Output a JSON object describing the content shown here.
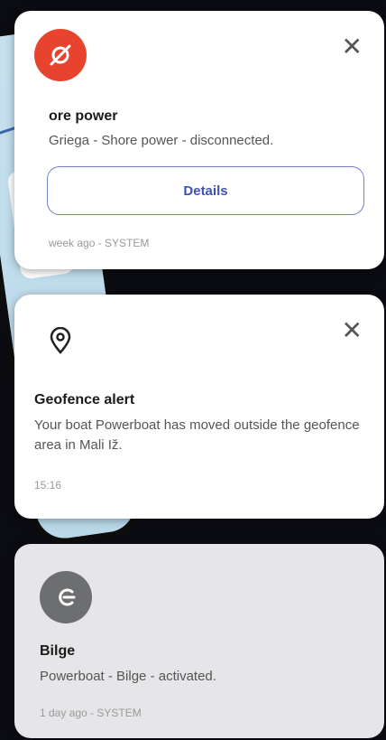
{
  "notifications": [
    {
      "icon": "plug-icon",
      "accent": "#e8432f",
      "title": "ore power",
      "body": "Griega - Shore power - disconnected.",
      "action_label": "Details",
      "meta": "week ago - SYSTEM"
    },
    {
      "icon": "location-pin-icon",
      "title": "Geofence alert",
      "body": "Your boat Powerboat has moved outside the geofence area in Mali Iž.",
      "meta": "15:16"
    },
    {
      "icon": "bilge-icon",
      "accent": "#6d6e70",
      "title": "Bilge",
      "body": "Powerboat - Bilge - activated.",
      "meta": "1 day ago - SYSTEM"
    }
  ],
  "background_phone": {
    "direction": "SE",
    "value": "1"
  },
  "close_glyph": "✕"
}
